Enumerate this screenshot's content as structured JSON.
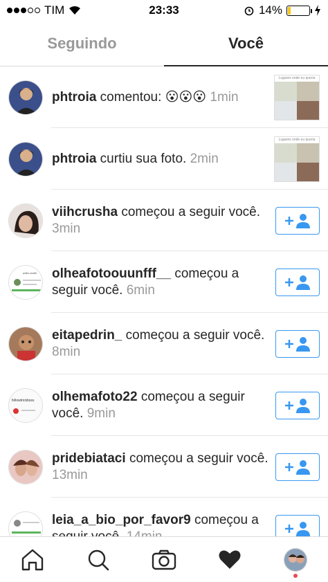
{
  "status_bar": {
    "carrier": "TIM",
    "time": "23:33",
    "battery": "14%"
  },
  "tabs": [
    {
      "label": "Seguindo",
      "active": false
    },
    {
      "label": "Você",
      "active": true
    }
  ],
  "notifications": [
    {
      "user": "phtroia",
      "action": "comentou:",
      "emoji": "😮😮😮",
      "time": "1min",
      "type": "comment"
    },
    {
      "user": "phtroia",
      "action": "curtiu sua foto.",
      "time": "2min",
      "type": "like"
    },
    {
      "user": "viihcrusha",
      "action": "começou a seguir você.",
      "time": "3min",
      "type": "follow"
    },
    {
      "user": "olheafotoouunfff__",
      "action": "começou a seguir você.",
      "time": "6min",
      "type": "follow"
    },
    {
      "user": "eitapedrin_",
      "action": "começou a seguir você.",
      "time": "8min",
      "type": "follow"
    },
    {
      "user": "olhemafoto22",
      "action": "começou a seguir você.",
      "time": "9min",
      "type": "follow"
    },
    {
      "user": "pridebiataci",
      "action": "começou a seguir você.",
      "time": "13min",
      "type": "follow"
    },
    {
      "user": "leia_a_bio_por_favor9",
      "action": "começou a seguir você.",
      "time": "14min",
      "type": "follow"
    }
  ],
  "thumbnail_caption": "Lugares onde eu queria tomar leite",
  "avatar_labels": {
    "olheafotoouunfff": "adilio.lardth",
    "olhemafoto22": "followtrickboss"
  },
  "bottom_nav": [
    "home-icon",
    "search-icon",
    "camera-icon",
    "heart-icon",
    "profile-avatar"
  ],
  "colors": {
    "accent": "#3897f0",
    "text": "#262626",
    "muted": "#999999",
    "divider": "#dbdbdb",
    "notification": "#ed4956"
  }
}
